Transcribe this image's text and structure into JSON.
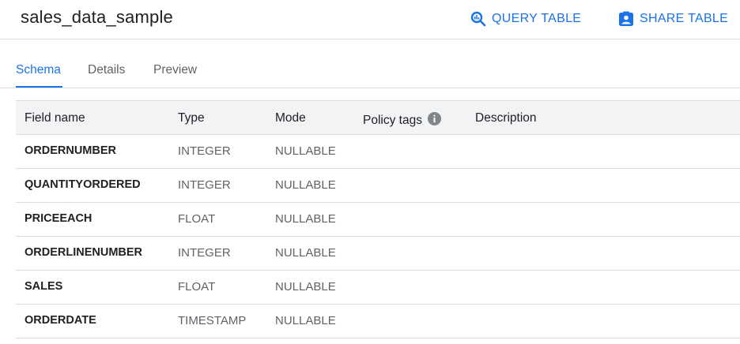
{
  "header": {
    "title": "sales_data_sample",
    "query_label": "QUERY TABLE",
    "share_label": "SHARE TABLE",
    "accent_color": "#1a73e8"
  },
  "tabs": [
    {
      "label": "Schema",
      "active": true
    },
    {
      "label": "Details",
      "active": false
    },
    {
      "label": "Preview",
      "active": false
    }
  ],
  "schema": {
    "columns": [
      "Field name",
      "Type",
      "Mode",
      "Policy tags",
      "Description"
    ],
    "policy_info_icon": "info-icon",
    "rows": [
      {
        "name": "ORDERNUMBER",
        "type": "INTEGER",
        "mode": "NULLABLE",
        "policy": "",
        "description": ""
      },
      {
        "name": "QUANTITYORDERED",
        "type": "INTEGER",
        "mode": "NULLABLE",
        "policy": "",
        "description": ""
      },
      {
        "name": "PRICEEACH",
        "type": "FLOAT",
        "mode": "NULLABLE",
        "policy": "",
        "description": ""
      },
      {
        "name": "ORDERLINENUMBER",
        "type": "INTEGER",
        "mode": "NULLABLE",
        "policy": "",
        "description": ""
      },
      {
        "name": "SALES",
        "type": "FLOAT",
        "mode": "NULLABLE",
        "policy": "",
        "description": ""
      },
      {
        "name": "ORDERDATE",
        "type": "TIMESTAMP",
        "mode": "NULLABLE",
        "policy": "",
        "description": ""
      }
    ]
  }
}
